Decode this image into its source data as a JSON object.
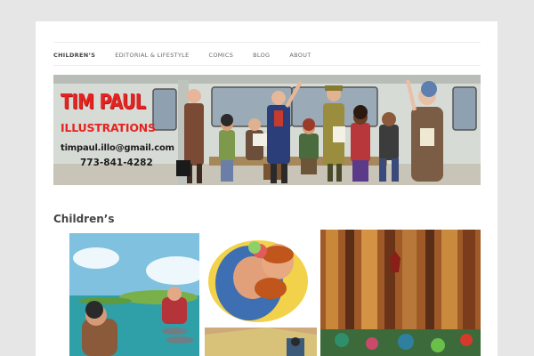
{
  "nav": {
    "items": [
      {
        "label": "Children’s",
        "active": true
      },
      {
        "label": "Editorial & Lifestyle",
        "active": false
      },
      {
        "label": "Comics",
        "active": false
      },
      {
        "label": "Blog",
        "active": false
      },
      {
        "label": "About",
        "active": false
      }
    ]
  },
  "banner": {
    "title": "TIM PAUL",
    "subtitle": "ILLUSTRATIONS",
    "email": "timpaul.illo@gmail.com",
    "phone": "773-841-4282"
  },
  "page": {
    "title": "Children’s"
  },
  "colors": {
    "page_background": "#e6e6e6",
    "content_background": "#ffffff",
    "brand_red": "#e52421",
    "nav_text": "#6a6a6a"
  }
}
